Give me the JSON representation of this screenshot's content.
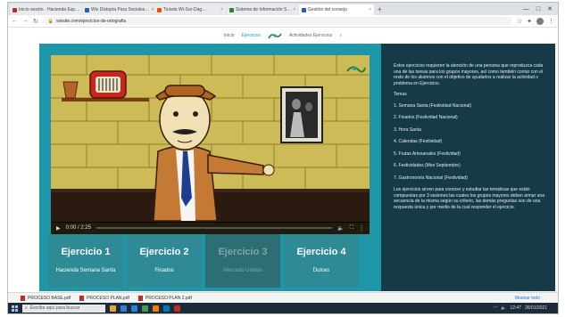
{
  "browser": {
    "tabs": [
      {
        "label": "Inicio sesión · Hacienda Esp…",
        "color": "#c62828",
        "active": false
      },
      {
        "label": "Wix Distopía Para Sociales…",
        "color": "#1565c0",
        "active": false
      },
      {
        "label": "Tickets Wi-Sur-Dag…",
        "color": "#e65100",
        "active": false
      },
      {
        "label": "Sistema de Información S…",
        "color": "#2e7d32",
        "active": false
      },
      {
        "label": "Gestión del consejo",
        "color": "#1565c0",
        "active": true
      }
    ],
    "new_tab": "+",
    "url": "wixsite.com/ejercicios-de-ortografia",
    "window_controls": [
      "—",
      "□",
      "✕"
    ]
  },
  "site_header": {
    "nav_left": "Inicio",
    "nav_active": "Ejercicios",
    "nav_right": "Actividades Ejercicios",
    "search_glyph": "⌕"
  },
  "exercises": [
    {
      "title": "Ejercicio 1",
      "subtitle": "Hacienda Semana Santa",
      "enabled": true
    },
    {
      "title": "Ejercicio 2",
      "subtitle": "Finados",
      "enabled": true
    },
    {
      "title": "Ejercicio 3",
      "subtitle": "Mercado Unidos",
      "enabled": false
    },
    {
      "title": "Ejercicio 4",
      "subtitle": "Dulces",
      "enabled": true
    }
  ],
  "video": {
    "time": "0:00 / 2:25",
    "progress": 0,
    "play_glyph": "▶",
    "volume_glyph": "🔈",
    "fullscreen_glyph": "⛶",
    "more_glyph": "⋮"
  },
  "instructions": {
    "intro": "Estos ejercicios requieren la atención de una persona que reproduzca cada una de las tareas para los grupos mayores, así como también contar con el resto de los alumnos con el objetivo de ayudarlos a realizar la actividad o problema en Ejercicios.",
    "list_title": "Temas",
    "items": [
      "1. Semana Santa (Festividad Nacional)",
      "2. Finados (Festividad Nacional)",
      "3. Hora Santa",
      "4. Calendas (Festividad)",
      "5. Frutas Artesanales (Festividad)",
      "6. Festividades (Mes Septiembre)",
      "7. Gastronomía Nacional (Festividad)"
    ],
    "closing": "Los ejercicios sirven para conocer y estudiar las temáticas que están compuestas por 3 sesiones las cuales los grupos mayores deben armar una secuencia de la misma según su criterio, las demás preguntas son de una respuesta única y por medio de la cual responder el ejercicio."
  },
  "downloads": {
    "items": [
      "PROCESO BASE.pdf",
      "PROCESO PLAN.pdf",
      "PROCESO PLAN 2.pdf"
    ],
    "show_all": "Mostrar todo"
  },
  "taskbar": {
    "search_placeholder": "Escribe aquí para buscar",
    "clock": "12:47",
    "date": "26/01/2021",
    "apps": [
      "#e8a33d",
      "#2d7fd6",
      "#1e88e5",
      "#43a047",
      "#f57c00",
      "#0277bd",
      "#c62828"
    ]
  }
}
